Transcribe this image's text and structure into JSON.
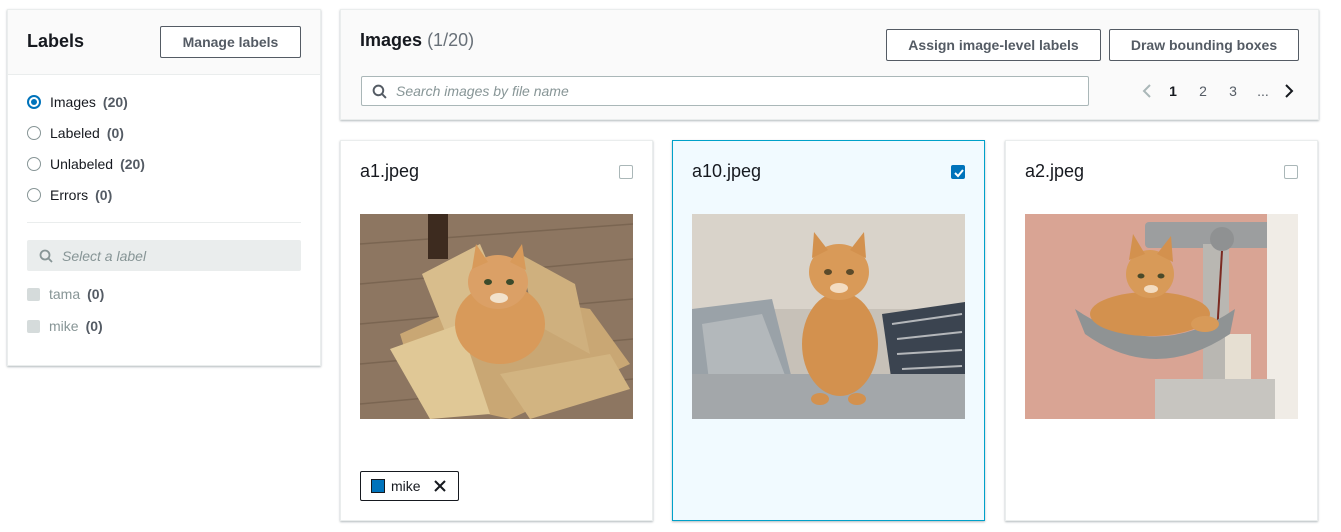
{
  "labels_panel": {
    "title": "Labels",
    "manage_button": "Manage labels",
    "filters": [
      {
        "name": "Images",
        "count": "(20)",
        "selected": true
      },
      {
        "name": "Labeled",
        "count": "(0)",
        "selected": false
      },
      {
        "name": "Unlabeled",
        "count": "(20)",
        "selected": false
      },
      {
        "name": "Errors",
        "count": "(0)",
        "selected": false
      }
    ],
    "label_search_placeholder": "Select a label",
    "labels": [
      {
        "name": "tama",
        "count": "(0)"
      },
      {
        "name": "mike",
        "count": "(0)"
      }
    ]
  },
  "images_panel": {
    "title": "Images",
    "count": "(1/20)",
    "assign_button": "Assign image-level labels",
    "draw_button": "Draw bounding boxes",
    "search_placeholder": "Search images by file name",
    "pagination": {
      "pages": [
        "1",
        "2",
        "3",
        "..."
      ],
      "current": "1"
    }
  },
  "cards": [
    {
      "filename": "a1.jpeg",
      "checked": false,
      "image": "orange tabby cat sitting in a cardboard box on wooden floor",
      "tags": [
        {
          "name": "mike",
          "color": "#0073bb"
        }
      ]
    },
    {
      "filename": "a10.jpeg",
      "checked": true,
      "image": "orange tabby cat sitting on a bed with blankets",
      "tags": []
    },
    {
      "filename": "a2.jpeg",
      "checked": false,
      "image": "orange tabby cat lying in a cat tree hammock",
      "tags": []
    }
  ],
  "colors": {
    "accent": "#0073bb",
    "selected_border": "#00a1c9",
    "selected_bg": "#f1faff"
  }
}
